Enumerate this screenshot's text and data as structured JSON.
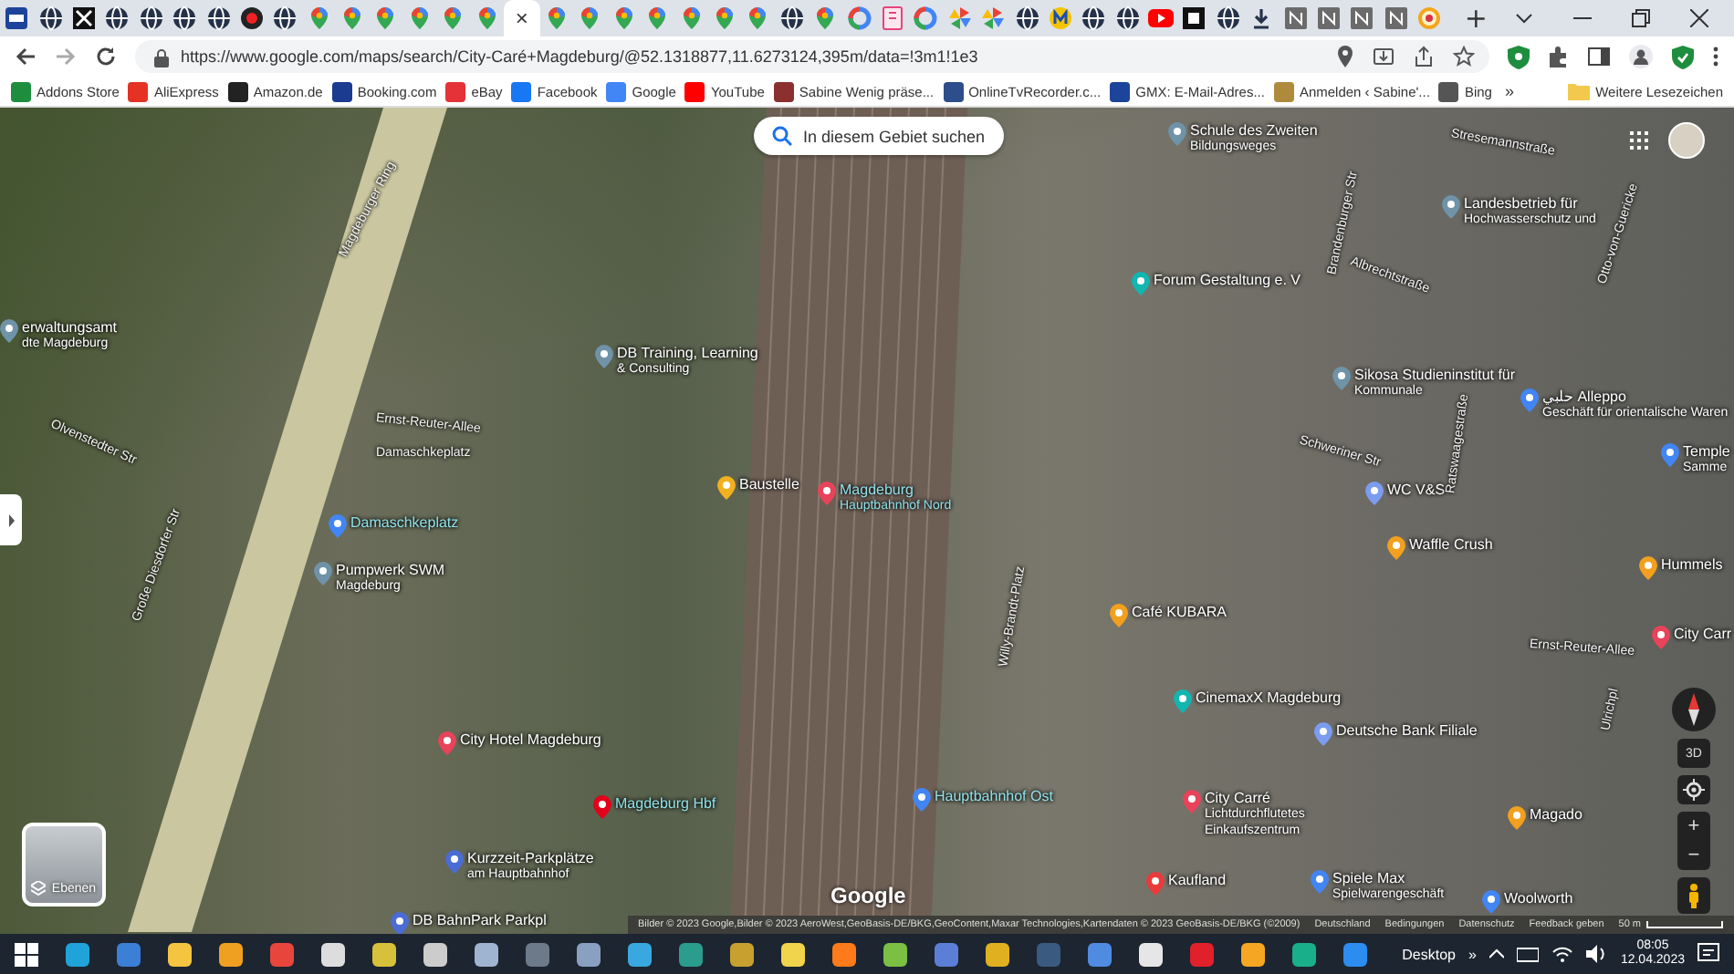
{
  "tab_strip": {
    "tabs": [
      {
        "kind": "gmx",
        "selected": false
      },
      {
        "kind": "globe",
        "selected": false
      },
      {
        "kind": "film",
        "selected": false
      },
      {
        "kind": "globe",
        "selected": false
      },
      {
        "kind": "globe",
        "selected": false
      },
      {
        "kind": "globe",
        "selected": false
      },
      {
        "kind": "globe",
        "selected": false
      },
      {
        "kind": "record",
        "selected": false
      },
      {
        "kind": "globe",
        "selected": false
      },
      {
        "kind": "maps",
        "selected": false
      },
      {
        "kind": "maps",
        "selected": false
      },
      {
        "kind": "maps",
        "selected": false
      },
      {
        "kind": "maps",
        "selected": false
      },
      {
        "kind": "maps",
        "selected": false
      },
      {
        "kind": "maps",
        "selected": false
      },
      {
        "kind": "maps",
        "selected": true,
        "close": "×"
      },
      {
        "kind": "maps",
        "selected": false
      },
      {
        "kind": "maps",
        "selected": false
      },
      {
        "kind": "maps",
        "selected": false
      },
      {
        "kind": "maps",
        "selected": false
      },
      {
        "kind": "maps",
        "selected": false
      },
      {
        "kind": "maps",
        "selected": false
      },
      {
        "kind": "maps",
        "selected": false
      },
      {
        "kind": "globe",
        "selected": false
      },
      {
        "kind": "maps",
        "selected": false
      },
      {
        "kind": "google",
        "selected": false
      },
      {
        "kind": "doc",
        "selected": false
      },
      {
        "kind": "google",
        "selected": false
      },
      {
        "kind": "pinwheel",
        "selected": false
      },
      {
        "kind": "pinwheel",
        "selected": false
      },
      {
        "kind": "globe",
        "selected": false
      },
      {
        "kind": "m",
        "selected": false
      },
      {
        "kind": "globe",
        "selected": false
      },
      {
        "kind": "globe",
        "selected": false
      },
      {
        "kind": "youtube",
        "selected": false
      },
      {
        "kind": "dark",
        "selected": false
      },
      {
        "kind": "globe",
        "selected": false
      },
      {
        "kind": "download",
        "selected": false
      },
      {
        "kind": "grey",
        "selected": false
      },
      {
        "kind": "grey",
        "selected": false
      },
      {
        "kind": "grey",
        "selected": false
      },
      {
        "kind": "grey",
        "selected": false
      },
      {
        "kind": "ring",
        "selected": false
      }
    ],
    "new_tab": "+"
  },
  "address_bar": {
    "url": "https://www.google.com/maps/search/City-Caré+Magdeburg/@52.1318877,11.6273124,395m/data=!3m1!1e3"
  },
  "bookmarks": {
    "items": [
      {
        "label": "Addons Store",
        "color": "#1e8e3e"
      },
      {
        "label": "AliExpress",
        "color": "#e43225"
      },
      {
        "label": "Amazon.de",
        "color": "#222222"
      },
      {
        "label": "Booking.com",
        "color": "#1a3b8f"
      },
      {
        "label": "eBay",
        "color": "#e53238"
      },
      {
        "label": "Facebook",
        "color": "#1877f2"
      },
      {
        "label": "Google",
        "color": "#4285f4"
      },
      {
        "label": "YouTube",
        "color": "#ff0000"
      },
      {
        "label": "Sabine Wenig präse...",
        "color": "#8b2f2f"
      },
      {
        "label": "OnlineTvRecorder.c...",
        "color": "#2d4e8a"
      },
      {
        "label": "GMX: E-Mail-Adres...",
        "color": "#1c449b"
      },
      {
        "label": "Anmelden ‹ Sabine'...",
        "color": "#b08a3c"
      },
      {
        "label": "Bing",
        "color": "#555555"
      }
    ],
    "more": "»",
    "other": "Weitere Lesezeichen"
  },
  "map": {
    "search_area_button": "In diesem Gebiet suchen",
    "labels": [
      {
        "kind": "place",
        "lines": [
          "erwaltungsamt",
          "dte Magdeburg"
        ],
        "color": "#6f93a8"
      },
      {
        "kind": "road",
        "lines": [
          "Magdeburger Ring"
        ]
      },
      {
        "kind": "road",
        "lines": [
          "Olvenstedter Str"
        ]
      },
      {
        "kind": "place",
        "lines": [
          "DB Training, Learning",
          "& Consulting"
        ],
        "color": "#6f93a8"
      },
      {
        "kind": "road",
        "lines": [
          "Ernst-Reuter-Allee"
        ]
      },
      {
        "kind": "road",
        "lines": [
          "Damaschkeplatz"
        ]
      },
      {
        "kind": "place",
        "lines": [
          "Baustelle"
        ],
        "color": "#f2b01e"
      },
      {
        "kind": "transit",
        "lines": [
          "Magdeburg",
          "Hauptbahnhof Nord"
        ],
        "color": "#e8435a"
      },
      {
        "kind": "place",
        "lines": [
          "Schule des Zweiten",
          "Bildungsweges"
        ],
        "color": "#6f93a8"
      },
      {
        "kind": "road",
        "lines": [
          "Brandenburger Str"
        ]
      },
      {
        "kind": "road",
        "lines": [
          "Stresemannstraße"
        ]
      },
      {
        "kind": "place",
        "lines": [
          "Landesbetrieb für",
          "Hochwasserschutz und"
        ],
        "color": "#6f93a8"
      },
      {
        "kind": "road",
        "lines": [
          "Albrechtstraße"
        ]
      },
      {
        "kind": "road",
        "lines": [
          "Otto-von-Guericke"
        ]
      },
      {
        "kind": "place",
        "lines": [
          "Forum Gestaltung e. V"
        ],
        "color": "#12b5b0"
      },
      {
        "kind": "place",
        "lines": [
          "Sikosa Studieninstitut für",
          "Kommunale"
        ],
        "color": "#6f93a8"
      },
      {
        "kind": "place",
        "lines": [
          "حلبي Alleppo",
          "Geschäft für orientalische Waren"
        ],
        "color": "#4285f4"
      },
      {
        "kind": "road",
        "lines": [
          "Schweriner Str"
        ]
      },
      {
        "kind": "place",
        "lines": [
          "WC V&S"
        ],
        "color": "#7b9cf0"
      },
      {
        "kind": "road",
        "lines": [
          "Ratswaagestraße"
        ]
      },
      {
        "kind": "place",
        "lines": [
          "Temple",
          "Samme"
        ],
        "color": "#4285f4"
      },
      {
        "kind": "road",
        "lines": [
          "Große Diesdorfer Str"
        ]
      },
      {
        "kind": "transit",
        "lines": [
          "Damaschkeplatz"
        ],
        "color": "#4285f4"
      },
      {
        "kind": "place",
        "lines": [
          "Pumpwerk SWM",
          "Magdeburg"
        ],
        "color": "#6f93a8"
      },
      {
        "kind": "place",
        "lines": [
          "Waffle Crush"
        ],
        "color": "#f2a01e"
      },
      {
        "kind": "place",
        "lines": [
          "Hummels"
        ],
        "color": "#f2a01e"
      },
      {
        "kind": "place",
        "lines": [
          "Café KUBARA"
        ],
        "color": "#f2a01e"
      },
      {
        "kind": "road",
        "lines": [
          "Ernst-Reuter-Allee"
        ]
      },
      {
        "kind": "place",
        "lines": [
          "City Carr"
        ],
        "color": "#e8435a"
      },
      {
        "kind": "road",
        "lines": [
          "Willy-Brandt-Platz"
        ]
      },
      {
        "kind": "place",
        "lines": [
          "CinemaxX Magdeburg"
        ],
        "color": "#12b5b0"
      },
      {
        "kind": "place",
        "lines": [
          "Deutsche Bank Filiale"
        ],
        "color": "#7b9cf0"
      },
      {
        "kind": "road",
        "lines": [
          "Ulrichpl"
        ]
      },
      {
        "kind": "place",
        "lines": [
          "City Hotel Magdeburg"
        ],
        "color": "#e8435a"
      },
      {
        "kind": "transit",
        "lines": [
          "Hauptbahnhof Ost"
        ],
        "color": "#4285f4"
      },
      {
        "kind": "place",
        "lines": [
          "City Carré",
          "Lichtdurchflutetes",
          "Einkaufszentrum"
        ],
        "color": "#e8435a"
      },
      {
        "kind": "place",
        "lines": [
          "Magado"
        ],
        "color": "#f2a01e"
      },
      {
        "kind": "transit",
        "lines": [
          "Magdeburg Hbf"
        ],
        "color": "#e2001a"
      },
      {
        "kind": "place",
        "lines": [
          "Kurzzeit-Parkplätze",
          "am Hauptbahnhof"
        ],
        "color": "#4a6cd4"
      },
      {
        "kind": "place",
        "lines": [
          "Kaufland"
        ],
        "color": "#e83b3b"
      },
      {
        "kind": "place",
        "lines": [
          "Spiele Max",
          "Spielwarengeschäft"
        ],
        "color": "#4285f4"
      },
      {
        "kind": "place",
        "lines": [
          "DB BahnPark Parkpl"
        ],
        "color": "#4a6cd4"
      },
      {
        "kind": "place",
        "lines": [
          "Woolworth"
        ],
        "color": "#4285f4"
      }
    ],
    "logo": "Google",
    "layers_label": "Ebenen",
    "tilt_label": "3D",
    "zoom_in": "+",
    "zoom_out": "−",
    "footer": [
      "Bilder © 2023 Google,Bilder © 2023 AeroWest,GeoBasis-DE/BKG,GeoContent,Maxar Technologies,Kartendaten © 2023 GeoBasis-DE/BKG (©2009)",
      "Deutschland",
      "Bedingungen",
      "Datenschutz",
      "Feedback geben"
    ],
    "scale": "50 m"
  },
  "taskbar": {
    "apps": [
      {
        "kind": "windows"
      },
      {
        "kind": "edge"
      },
      {
        "kind": "mail"
      },
      {
        "kind": "folder"
      },
      {
        "kind": "s"
      },
      {
        "kind": "chrome"
      },
      {
        "kind": "gear"
      },
      {
        "kind": "figure"
      },
      {
        "kind": "eye"
      },
      {
        "kind": "photo"
      },
      {
        "kind": "note"
      },
      {
        "kind": "cube"
      },
      {
        "kind": "aperture"
      },
      {
        "kind": "laptop"
      },
      {
        "kind": "letters"
      },
      {
        "kind": "notes"
      },
      {
        "kind": "firefox"
      },
      {
        "kind": "leaf"
      },
      {
        "kind": "pc"
      },
      {
        "kind": "bug"
      },
      {
        "kind": "terminal"
      },
      {
        "kind": "shield"
      },
      {
        "kind": "white"
      },
      {
        "kind": "opera"
      },
      {
        "kind": "vpn"
      },
      {
        "kind": "e"
      },
      {
        "kind": "down"
      }
    ],
    "desktop": "Desktop",
    "more": "»",
    "time": "08:05",
    "date": "12.04.2023"
  }
}
